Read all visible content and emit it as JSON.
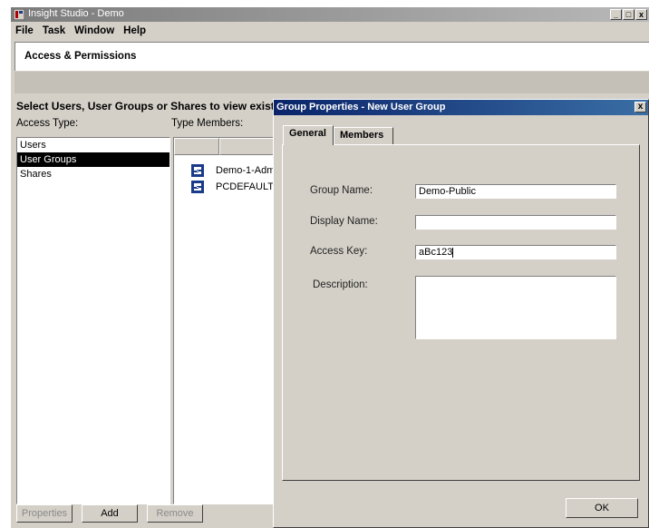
{
  "window": {
    "title": "Insight Studio - Demo",
    "controls": [
      "_",
      "□",
      "x"
    ]
  },
  "menu": [
    "File",
    "Task",
    "Window",
    "Help"
  ],
  "banner": {
    "title": "Access & Permissions"
  },
  "instruction": "Select Users, User Groups or Shares to view existing members",
  "access_type": {
    "label": "Access Type:",
    "items": [
      {
        "label": "Users",
        "selected": false
      },
      {
        "label": "User Groups",
        "selected": true
      },
      {
        "label": "Shares",
        "selected": false
      }
    ]
  },
  "type_members": {
    "label": "Type Members:",
    "items": [
      {
        "label": "Demo-1-Adm",
        "icon": "user-group-icon"
      },
      {
        "label": "PCDEFAULT",
        "icon": "user-group-icon"
      }
    ]
  },
  "buttons": {
    "properties": "Properties",
    "add": "Add",
    "remove": "Remove"
  },
  "dialog": {
    "title": "Group Properties - New User Group",
    "close": "x",
    "tabs": [
      "General",
      "Members"
    ],
    "active_tab": "General",
    "fields": {
      "group_name": {
        "label": "Group Name:",
        "value": "Demo-Public"
      },
      "display_name": {
        "label": "Display Name:",
        "value": ""
      },
      "access_key": {
        "label": "Access Key:",
        "value": "aBc123"
      },
      "description": {
        "label": "Description:",
        "value": ""
      }
    },
    "ok": "OK"
  }
}
